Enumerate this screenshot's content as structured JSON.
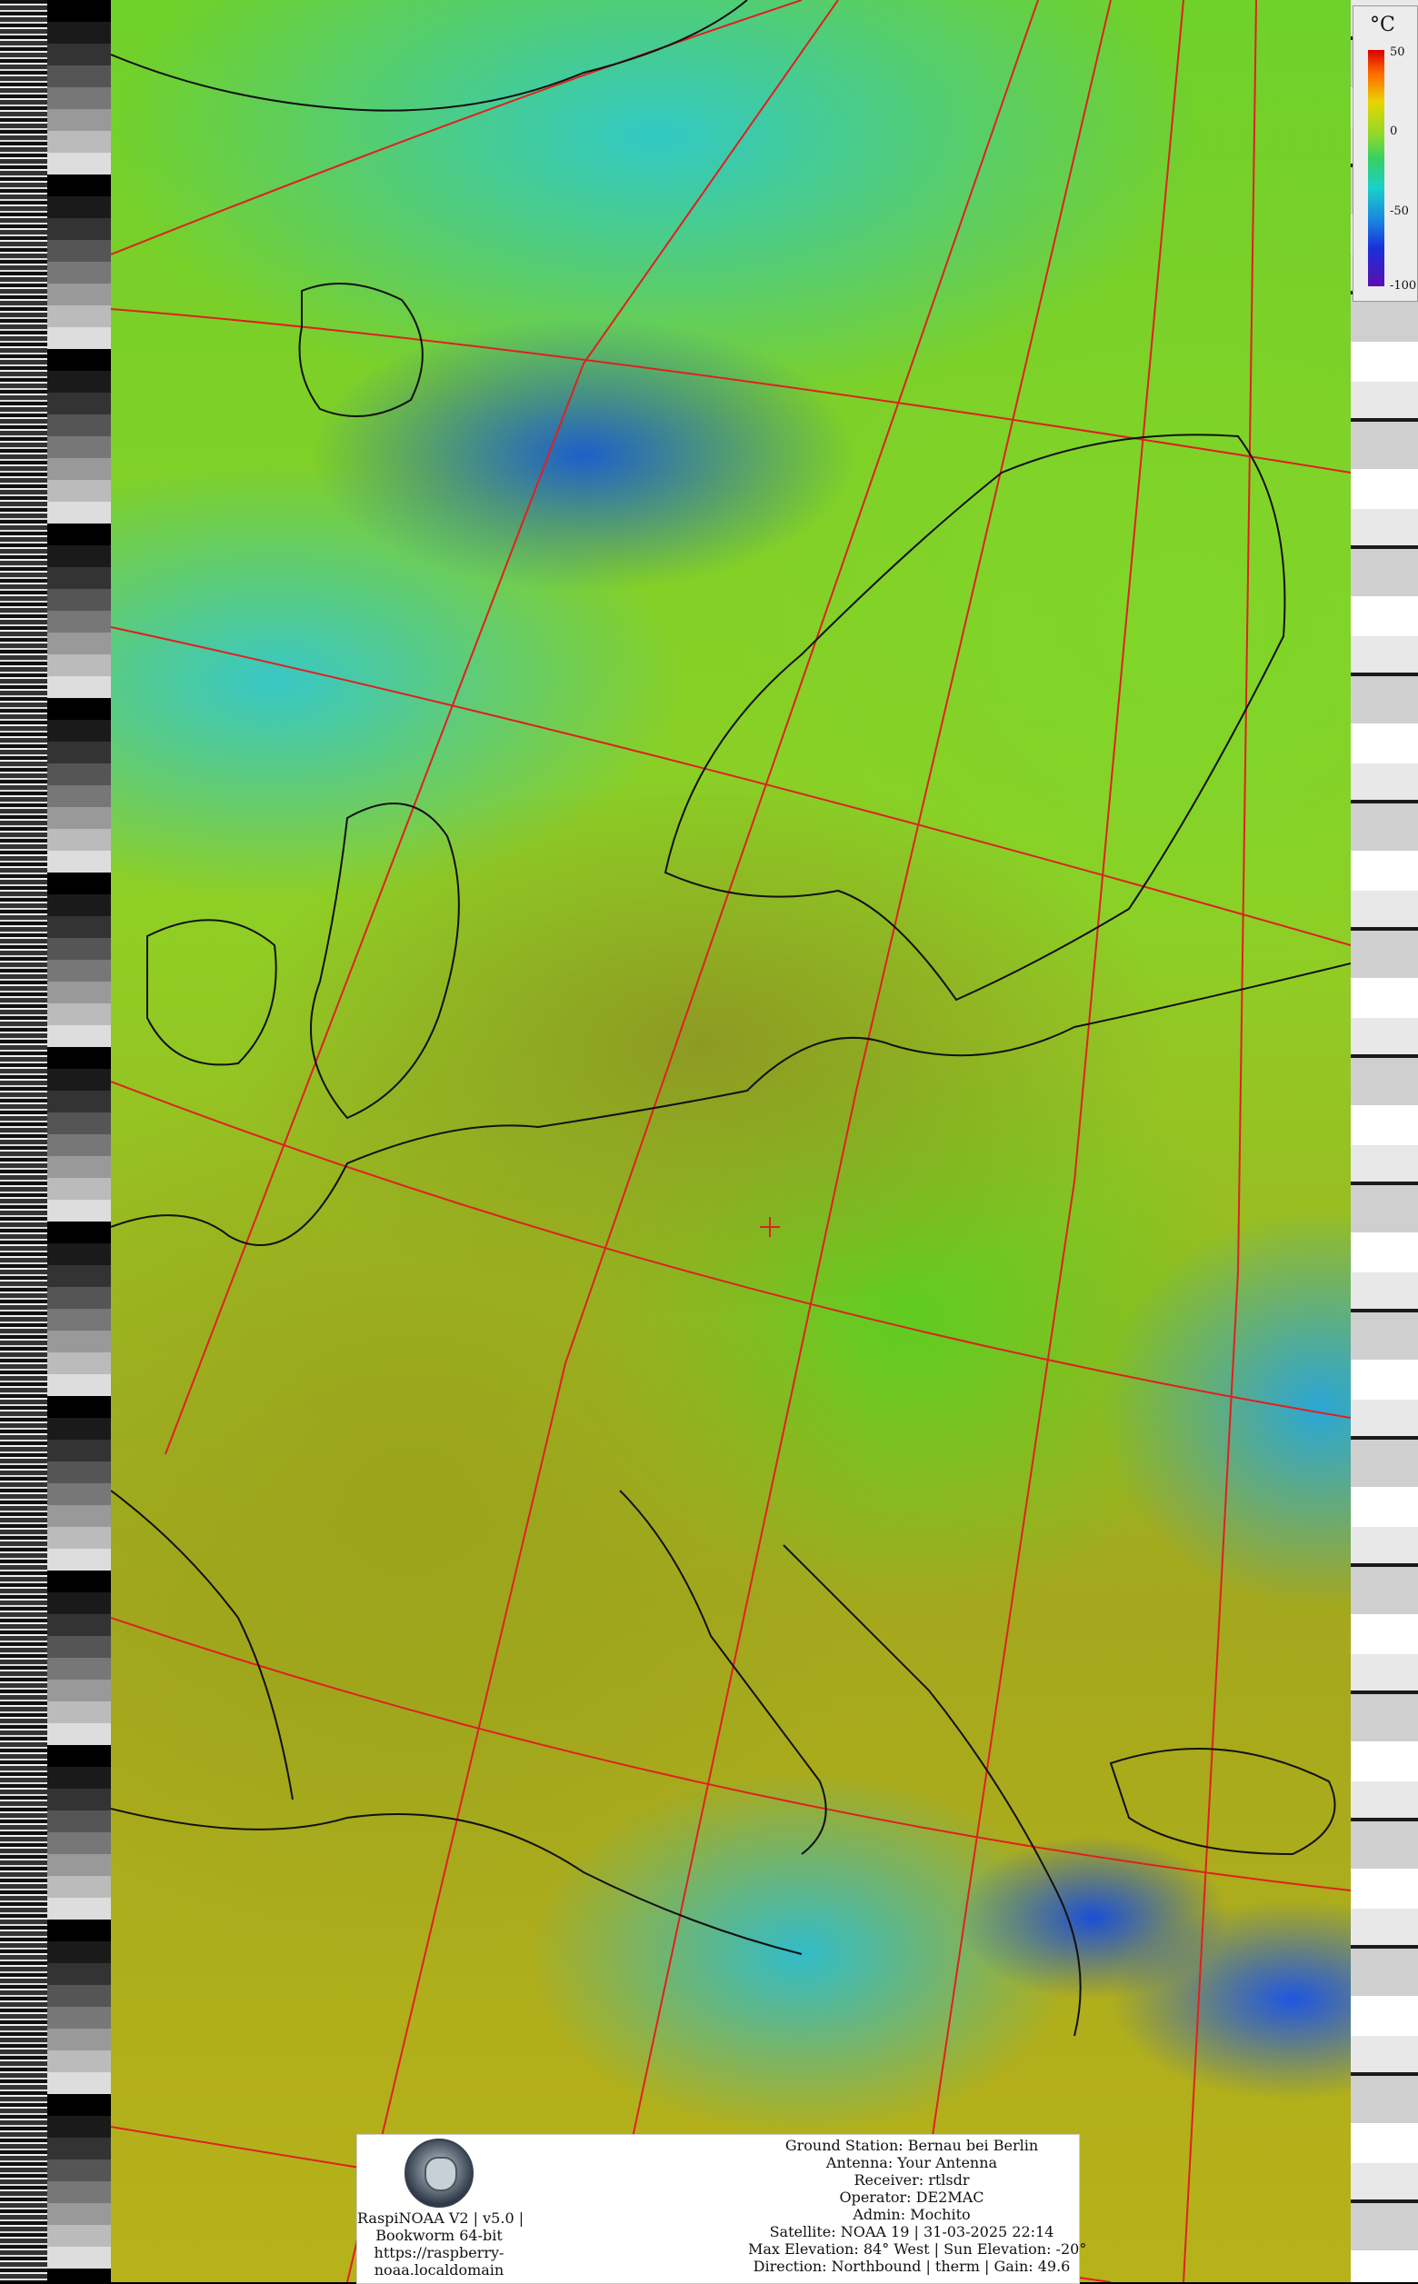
{
  "legend": {
    "unit": "°C",
    "ticks": [
      "50",
      "0",
      "-50",
      "-100"
    ]
  },
  "info_panel": {
    "left_lines": [
      "RaspiNOAA V2 | v5.0 |",
      "Bookworm 64-bit",
      "https://raspberry-",
      "noaa.localdomain"
    ],
    "right_lines": [
      "Ground Station: Bernau bei Berlin",
      "Antenna: Your Antenna",
      "Receiver: rtlsdr",
      "Operator: DE2MAC",
      "Admin: Mochito",
      "Satellite: NOAA 19 | 31-03-2025 22:14",
      "Max Elevation: 84° West | Sun Elevation: -20°",
      "Direction: Northbound | therm | Gain: 49.6"
    ]
  },
  "colors": {
    "grid_line": "#e02020",
    "coastline": "#111111",
    "station_marker": "#e02020"
  }
}
